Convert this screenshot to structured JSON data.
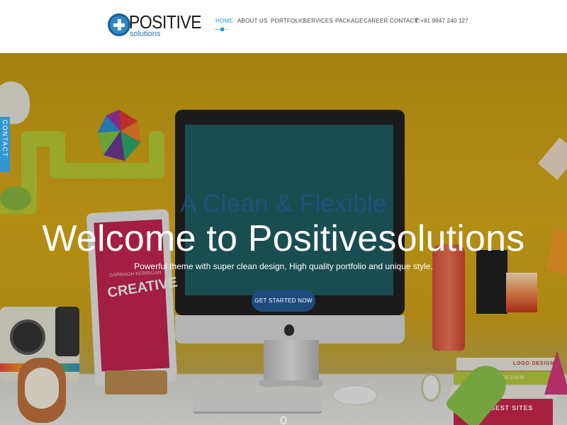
{
  "brand": {
    "name": "POSITIVE",
    "tagline": "solutions"
  },
  "nav": {
    "items": [
      {
        "label": "HOME",
        "active": true
      },
      {
        "label": "ABOUT US"
      },
      {
        "label": "PORTFOLIO"
      },
      {
        "label": "SERVICES"
      },
      {
        "label": "PACKAGE"
      },
      {
        "label": "CAREER"
      },
      {
        "label": "CONTACT"
      }
    ],
    "phone": "+91 9947 240 127"
  },
  "hero": {
    "pre_title": "A Clean & Flexible",
    "title": "Welcome to Positivesolutions",
    "description": "Powerful theme with super clean design, High quality portfolio and unique style,",
    "cta_label": "GET STARTED NOW"
  },
  "contact_tab": {
    "label": "CONTACT"
  },
  "scene": {
    "tablet_name": "DARRAGH KERRIGAN",
    "tablet_word": "CREATIVE",
    "books": [
      "LOGO DESIGN",
      "DISPLAY DESIGN",
      "THE BEST SITES"
    ]
  },
  "colors": {
    "accent": "#2b9ad6",
    "cta": "#1f4b7c",
    "hero_bg": "#d8a815"
  }
}
